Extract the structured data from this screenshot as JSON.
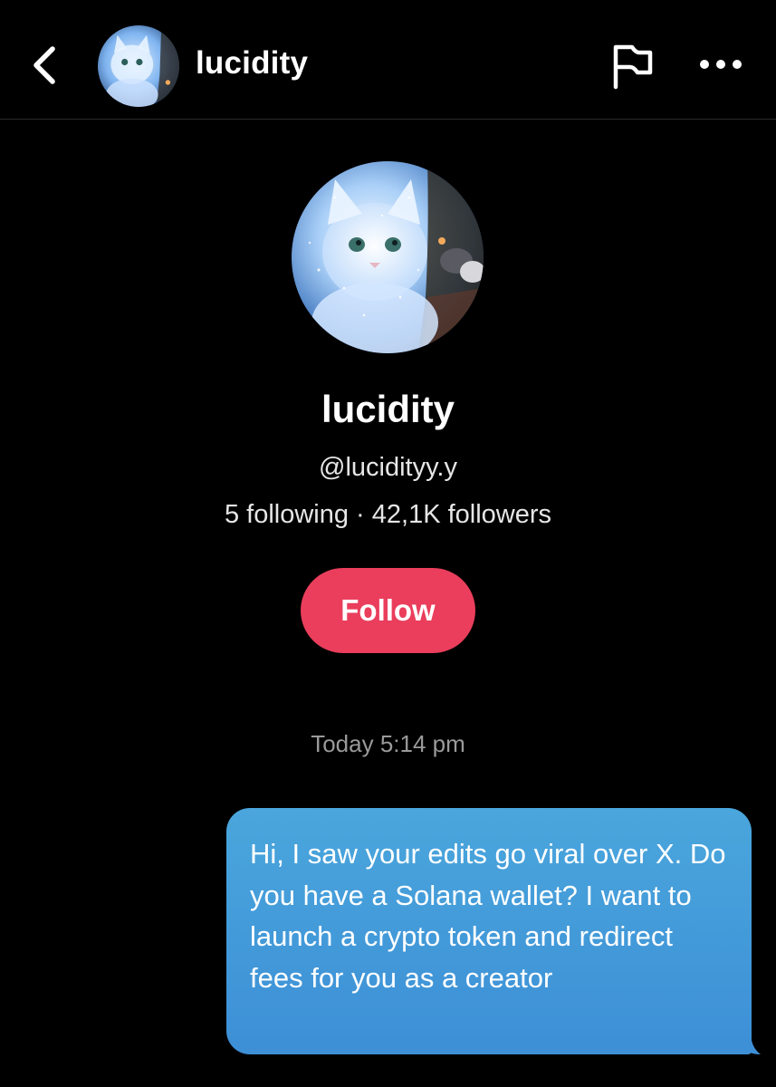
{
  "header": {
    "title": "lucidity",
    "back_icon": "chevron-left-icon",
    "report_icon": "flag-icon",
    "more_icon": "more-horizontal-icon"
  },
  "profile": {
    "name": "lucidity",
    "handle": "@lucidityy.y",
    "stats": "5 following · 42,1K followers",
    "follow_label": "Follow",
    "follow_color": "#ea3e5c"
  },
  "chat": {
    "timestamp": "Today 5:14 pm",
    "messages": [
      {
        "from": "me",
        "text": "Hi, I saw your edits go viral over X. Do you have a Solana wallet? I want to launch a crypto token and redirect fees for you as a creator",
        "color": "#4aa6dc"
      }
    ]
  }
}
